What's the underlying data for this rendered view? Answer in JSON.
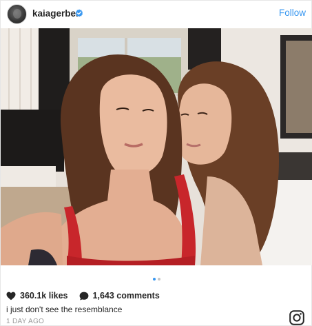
{
  "header": {
    "username": "kaiagerber",
    "follow_label": "Follow",
    "verified": true
  },
  "colors": {
    "link_blue": "#3897f0",
    "verified_blue": "#3897f0",
    "text": "#262626",
    "muted": "#999999"
  },
  "carousel": {
    "total": 2,
    "current": 1
  },
  "stats": {
    "likes_label": "360.1k likes",
    "comments_label": "1,643 comments"
  },
  "caption": {
    "text": "i just don't see the resemblance"
  },
  "timestamp": "1 DAY AGO",
  "icons": [
    "verified-badge-icon",
    "heart-icon",
    "comment-bubble-icon",
    "instagram-logo-icon"
  ]
}
